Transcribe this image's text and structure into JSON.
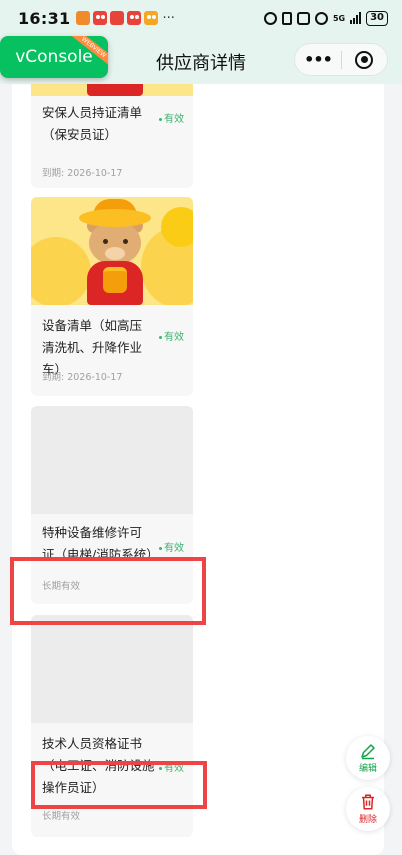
{
  "status_bar": {
    "time": "16:31",
    "more": "···",
    "network": "5G",
    "battery": "30"
  },
  "nav": {
    "title": "供应商详情",
    "more_label": "•••"
  },
  "vconsole": {
    "label": "vConsole",
    "ribbon": "WEBVIEW"
  },
  "cards": [
    {
      "title": "安保人员持证清单（保安员证）",
      "status": "有效",
      "expiry": "到期: 2026-10-17"
    },
    {
      "title": "设备清单（如高压清洗机、升降作业车）",
      "status": "有效",
      "expiry": "到期: 2026-10-17"
    },
    {
      "title": "特种设备维修许可证（电梯/消防系统）",
      "status": "有效",
      "expiry": "长期有效"
    },
    {
      "title": "技术人员资格证书（电工证、消防设施操作员证）",
      "status": "有效",
      "expiry": "长期有效"
    }
  ],
  "actions": {
    "edit": "编辑",
    "delete": "删除"
  },
  "colors": {
    "header_bg": "#e6f4ef",
    "status_green": "#3cb371",
    "annotation_red": "#ef4444",
    "delete_red": "#dc2626",
    "vconsole_green": "#07c160"
  }
}
